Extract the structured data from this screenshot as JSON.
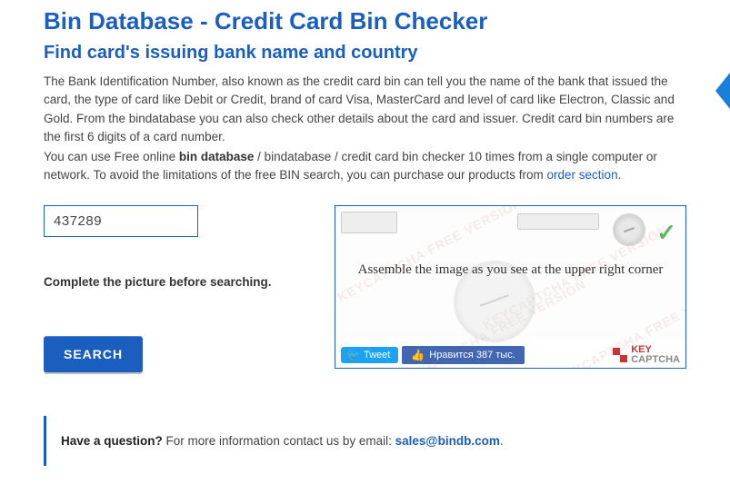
{
  "header": {
    "title": "Bin Database - Credit Card Bin Checker",
    "subtitle": "Find card's issuing bank name and country"
  },
  "intro": {
    "para1_a": "The Bank Identification Number, also known as the credit card bin can tell you the name of the bank that issued the card, the type of card like Debit or Credit, brand of card Visa, MasterCard and level of card like Electron, Classic and Gold. From the bindatabase you can also check other details about the card and issuer. Credit card bin numbers are the first 6 digits of a card number.",
    "para2_a": "You can use Free online ",
    "para2_strong": "bin database",
    "para2_b": " / bindatabase / credit card bin checker 10 times from a single computer or network. To avoid the limitations of the free BIN search, you can purchase our products from ",
    "para2_link": "order section",
    "para2_c": "."
  },
  "form": {
    "bin_value": "437289",
    "instruction": "Complete the picture before searching.",
    "search_label": "SEARCH"
  },
  "captcha": {
    "instruction": "Assemble the image as you see at the upper right corner",
    "watermark": "KEYCAPTCHA FREE VERSION",
    "tweet_label": "Tweet",
    "fb_label": "Нравится 387 тыс.",
    "kc_top": "KEY",
    "kc_bottom": "CAPTCHA"
  },
  "question": {
    "lead": "Have a question?",
    "text": " For more information contact us by email: ",
    "email": "sales@bindb.com",
    "tail": "."
  }
}
